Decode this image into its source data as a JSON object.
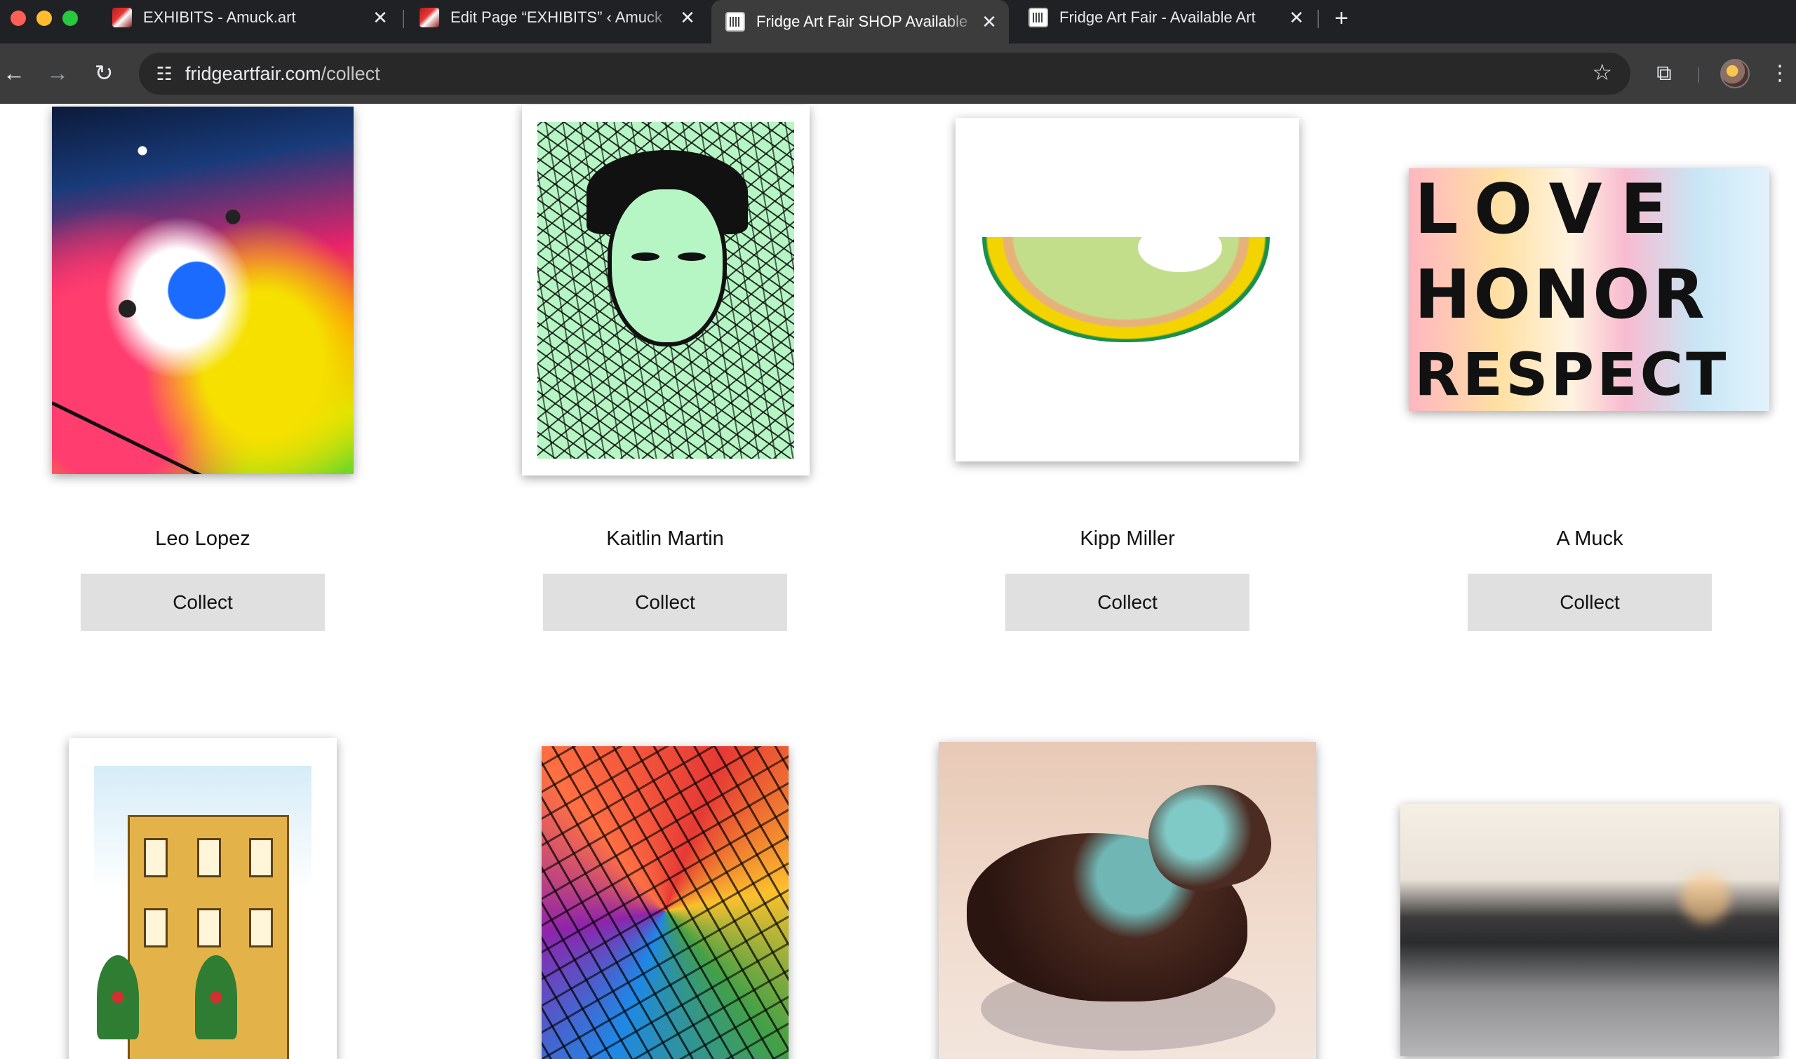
{
  "browser": {
    "tabs": [
      {
        "title": "EXHIBITS - Amuck.art",
        "active": false
      },
      {
        "title": "Edit Page “EXHIBITS” ‹ Amuck",
        "active": false
      },
      {
        "title": "Fridge Art Fair SHOP Available",
        "active": true
      },
      {
        "title": "Fridge Art Fair - Available Art",
        "active": false
      }
    ],
    "url_host": "fridgeartfair.com",
    "url_path": "/collect"
  },
  "artworks": [
    {
      "artist": "Leo Lopez",
      "button": "Collect"
    },
    {
      "artist": "Kaitlin Martin",
      "button": "Collect"
    },
    {
      "artist": "Kipp Miller",
      "button": "Collect"
    },
    {
      "artist": "A Muck",
      "button": "Collect"
    }
  ],
  "artwork_text": {
    "love_honor_respect": [
      "LOVE",
      "HONOR",
      "RESPECT"
    ]
  }
}
